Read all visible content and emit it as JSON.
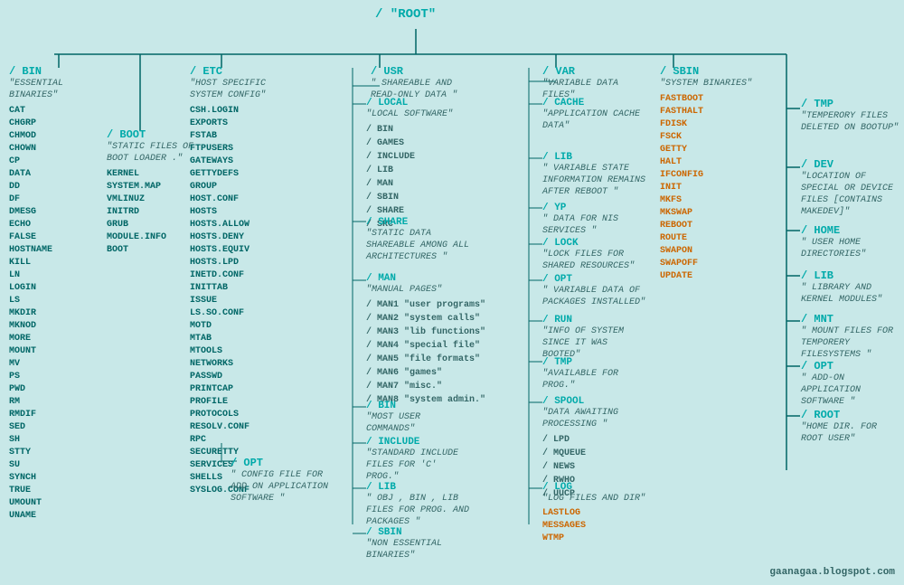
{
  "title": "/ \"ROOT\"",
  "watermark": "gaanagaa.blogspot.com",
  "bin": {
    "name": "/ BIN",
    "desc": "\"ESSENTIAL BINARIES\"",
    "files": [
      "CAT",
      "CHGRP",
      "CHMOD",
      "CHOWN",
      "CP",
      "DATA",
      "DD",
      "DF",
      "DMESG",
      "ECHO",
      "FALSE",
      "HOSTNAME",
      "KILL",
      "LN",
      "LOGIN",
      "LS",
      "MKDIR",
      "MKNOD",
      "MORE",
      "MOUNT",
      "MV",
      "PS",
      "PWD",
      "RM",
      "RMDIF",
      "SED",
      "SH",
      "STTY",
      "SU",
      "SYNCH",
      "TRUE",
      "UMOUNT",
      "UNAME"
    ]
  },
  "boot": {
    "name": "/ BOOT",
    "desc": "\"STATIC FILES OF BOOT LOADER .\"",
    "files": [
      "KERNEL",
      "SYSTEM.MAP",
      "VMLINUZ",
      "INITRD",
      "GRUB",
      "MODULE.INFO",
      "BOOT"
    ]
  },
  "etc": {
    "name": "/ ETC",
    "desc": "\"HOST SPECIFIC SYSTEM CONFIG\"",
    "files": [
      "CSH.LOGIN",
      "EXPORTS",
      "FSTAB",
      "FTPUSERS",
      "GATEWAYS",
      "GETTYDEFS",
      "GROUP",
      "HOST.CONF",
      "HOSTS",
      "HOSTS.ALLOW",
      "HOSTS.DENY",
      "HOSTS.EQUIV",
      "HOSTS.LPD",
      "INETD.CONF",
      "INITTAB",
      "ISSUE",
      "LS.SO.CONF",
      "MOTD",
      "MTAB",
      "MTOOLS",
      "NETWORKS",
      "PASSWD",
      "PRINTCAP",
      "PROFILE",
      "PROTOCOLS",
      "RESOLV.CONF",
      "RPC",
      "SECURETTY",
      "SERVICES",
      "SHELLS",
      "SYSLOG.CONF"
    ]
  },
  "etc_opt": {
    "name": "/ OPT",
    "desc": "\" CONFIG FILE FOR ADD ON APPLICATION SOFTWARE \""
  },
  "usr": {
    "name": "/ USR",
    "desc": "\" SHAREABLE AND READ-ONLY DATA \""
  },
  "usr_local": {
    "name": "/ LOCAL",
    "desc": "\"LOCAL SOFTWARE\"",
    "subdirs": [
      "/ BIN",
      "/ GAMES",
      "/ INCLUDE",
      "/ LIB",
      "/ MAN",
      "/ SBIN",
      "/ SHARE",
      "/ SRC"
    ]
  },
  "usr_share": {
    "name": "/ SHARE",
    "desc": "\"STATIC DATA SHAREABLE AMONG ALL ARCHITECTURES \""
  },
  "usr_man": {
    "name": "/ MAN",
    "desc": "\"MANUAL PAGES\"",
    "subdirs": [
      "/ MAN1 \"user programs\"",
      "/ MAN2 \"system calls\"",
      "/ MAN3 \"lib functions\"",
      "/ MAN4 \"special file\"",
      "/ MAN5 \"file formats\"",
      "/ MAN6 \"games\"",
      "/ MAN7 \"misc.\"",
      "/ MAN8 \"system admin.\""
    ]
  },
  "usr_bin": {
    "name": "/ BIN",
    "desc": "\"MOST USER COMMANDS\""
  },
  "usr_include": {
    "name": "/ INCLUDE",
    "desc": "\"STANDARD INCLUDE FILES FOR 'C' PROG.\""
  },
  "usr_lib": {
    "name": "/ LIB",
    "desc": "\" OBJ , BIN , LIB FILES FOR PROG. AND PACKAGES \""
  },
  "usr_sbin": {
    "name": "/ SBIN",
    "desc": "\"NON ESSENTIAL BINARIES\""
  },
  "var": {
    "name": "/ VAR",
    "desc": "\"VARIABLE DATA FILES\""
  },
  "var_cache": {
    "name": "/ CACHE",
    "desc": "\"APPLICATION CACHE DATA\""
  },
  "var_lib": {
    "name": "/ LIB",
    "desc": "\" VARIABLE STATE INFORMATION REMAINS AFTER REBOOT \""
  },
  "var_yp": {
    "name": "/ YP",
    "desc": "\" DATA FOR NIS SERVICES \""
  },
  "var_lock": {
    "name": "/ LOCK",
    "desc": "\"LOCK FILES FOR SHARED RESOURCES\""
  },
  "var_opt": {
    "name": "/ OPT",
    "desc": "\" VARIABLE DATA OF PACKAGES INSTALLED\""
  },
  "var_run": {
    "name": "/ RUN",
    "desc": "\"INFO OF SYSTEM SINCE IT WAS BOOTED\""
  },
  "var_tmp": {
    "name": "/ TMP",
    "desc": "\"AVAILABLE FOR PROG.\""
  },
  "var_spool": {
    "name": "/ SPOOL",
    "desc": "\"DATA AWAITING PROCESSING \"",
    "subdirs": [
      "/ LPD",
      "/ MQUEUE",
      "/ NEWS",
      "/ RWHO",
      "/ UUCP"
    ]
  },
  "var_log": {
    "name": "/ LOG",
    "desc": "\"LOG FILES AND DIR\"",
    "files_orange": [
      "LASTLOG",
      "MESSAGES",
      "WTMP"
    ]
  },
  "sbin": {
    "name": "/ SBIN",
    "desc": "\"SYSTEM BINARIES\"",
    "files_orange": [
      "FASTBOOT",
      "FASTHALT",
      "FDISK",
      "FSCK",
      "GETTY",
      "HALT",
      "IFCONFIG",
      "INIT",
      "MKFS",
      "MKSWAP",
      "REBOOT",
      "ROUTE",
      "SWAPON",
      "SWAPOFF",
      "UPDATE"
    ]
  },
  "tmp": {
    "name": "/ TMP",
    "desc": "\"TEMPERORY FILES DELETED ON BOOTUP\""
  },
  "dev": {
    "name": "/ DEV",
    "desc": "\"LOCATION OF SPECIAL OR DEVICE FILES [CONTAINS MAKEDEV]\""
  },
  "home": {
    "name": "/ HOME",
    "desc": "\" USER HOME DIRECTORIES\""
  },
  "lib": {
    "name": "/ LIB",
    "desc": "\"  LIBRARY AND KERNEL MODULES\""
  },
  "mnt": {
    "name": "/ MNT",
    "desc": "\"  MOUNT FILES FOR TEMPORERY FILESYSTEMS \""
  },
  "opt": {
    "name": "/ OPT",
    "desc": "\" ADD-ON APPLICATION SOFTWARE \""
  },
  "root_dir": {
    "name": "/ ROOT",
    "desc": "\"HOME DIR. FOR ROOT USER\""
  }
}
